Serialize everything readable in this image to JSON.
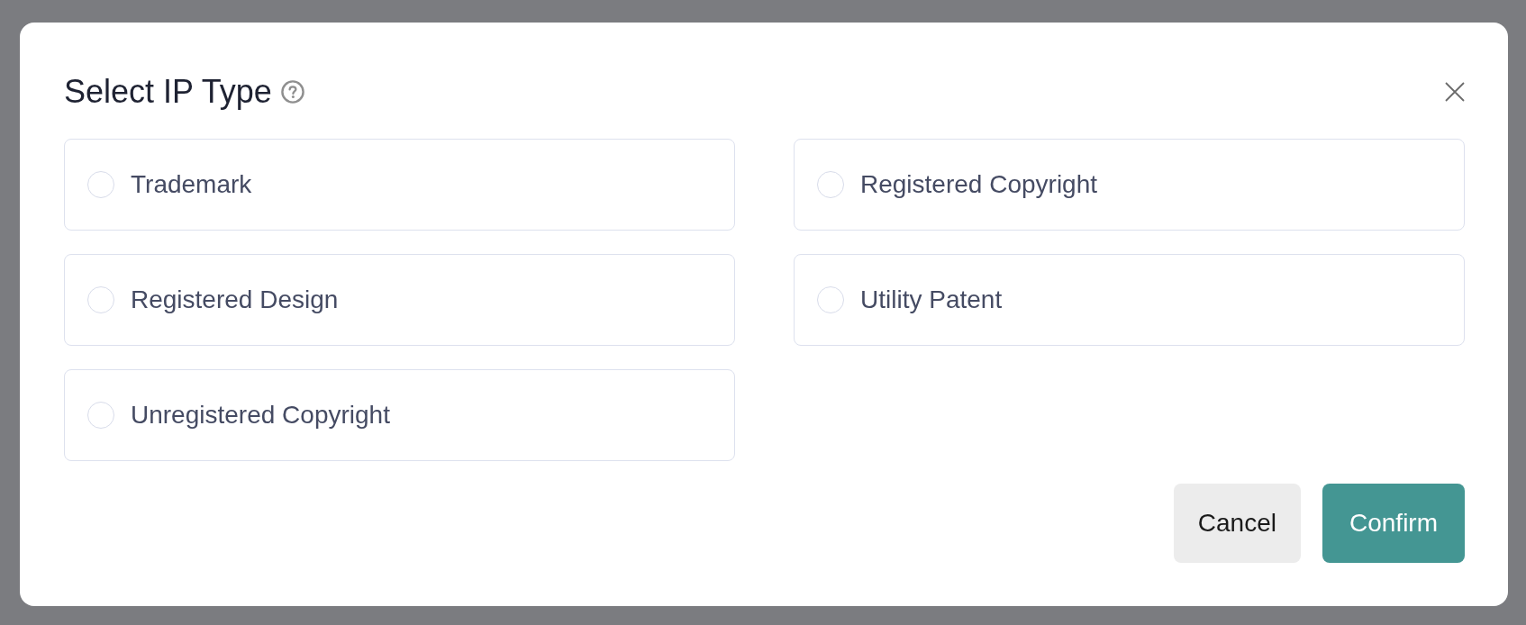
{
  "dialog": {
    "title": "Select IP Type",
    "options": [
      {
        "label": "Trademark",
        "selected": false
      },
      {
        "label": "Registered Copyright",
        "selected": false
      },
      {
        "label": "Registered Design",
        "selected": false
      },
      {
        "label": "Utility Patent",
        "selected": false
      },
      {
        "label": "Unregistered Copyright",
        "selected": false
      }
    ],
    "buttons": [
      {
        "label": "Cancel",
        "kind": "secondary"
      },
      {
        "label": "Confirm",
        "kind": "primary"
      }
    ]
  }
}
